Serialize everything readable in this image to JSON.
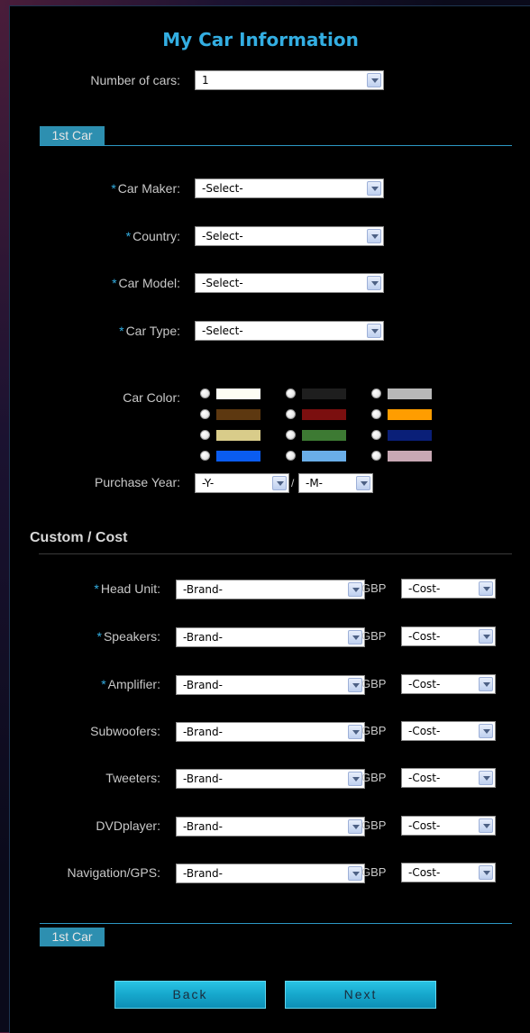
{
  "title": "My Car Information",
  "num_cars": {
    "label": "Number of cars:",
    "value": "1"
  },
  "tab_label": "1st Car",
  "car_fields": [
    {
      "required": true,
      "label": "Car Maker:",
      "value": "-Select-"
    },
    {
      "required": true,
      "label": "Country:",
      "value": "-Select-"
    },
    {
      "required": true,
      "label": "Car Model:",
      "value": "-Select-"
    },
    {
      "required": true,
      "label": "Car Type:",
      "value": "-Select-"
    }
  ],
  "car_color": {
    "label": "Car Color:",
    "swatches": [
      "#fdfdf3",
      "#1e1e1e",
      "#b8b8b8",
      "#5d3810",
      "#7b0f0f",
      "#ff9d00",
      "#d9cc8a",
      "#3d7a33",
      "#0a1f78",
      "#0a5cf0",
      "#6aaee8",
      "#c8a8b4"
    ]
  },
  "purchase_year": {
    "label": "Purchase Year:",
    "year": "-Y-",
    "separator": "/",
    "month": "-M-"
  },
  "custom_section": "Custom / Cost",
  "required_mark": "*",
  "currency": "GBP",
  "components": [
    {
      "required": true,
      "label": "Head Unit:",
      "brand": "-Brand-",
      "cost": "-Cost-"
    },
    {
      "required": true,
      "label": "Speakers:",
      "brand": "-Brand-",
      "cost": "-Cost-"
    },
    {
      "required": true,
      "label": "Amplifier:",
      "brand": "-Brand-",
      "cost": "-Cost-"
    },
    {
      "required": false,
      "label": "Subwoofers:",
      "brand": "-Brand-",
      "cost": "-Cost-"
    },
    {
      "required": false,
      "label": "Tweeters:",
      "brand": "-Brand-",
      "cost": "-Cost-"
    },
    {
      "required": false,
      "label": "DVDplayer:",
      "brand": "-Brand-",
      "cost": "-Cost-"
    },
    {
      "required": false,
      "label": "Navigation/GPS:",
      "brand": "-Brand-",
      "cost": "-Cost-"
    }
  ],
  "buttons": {
    "back": "Back",
    "next": "Next"
  }
}
